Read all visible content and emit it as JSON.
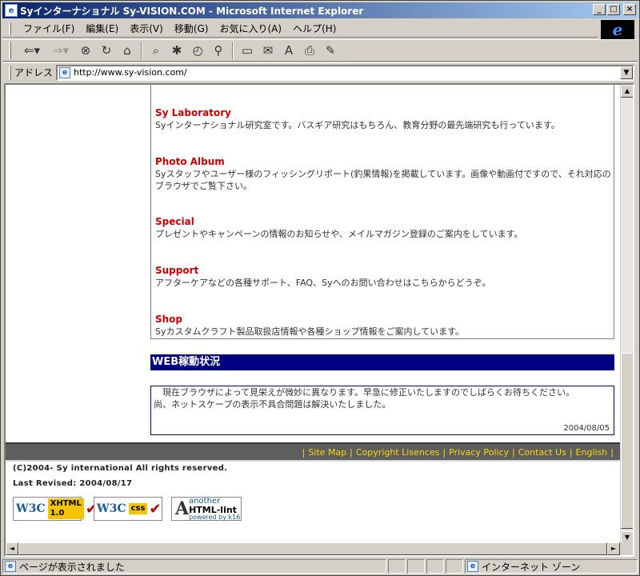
{
  "window": {
    "title": "Syインターナショナル Sy-VISION.COM - Microsoft Internet Explorer"
  },
  "menu": {
    "items": [
      "ファイル(F)",
      "編集(E)",
      "表示(V)",
      "移動(G)",
      "お気に入り(A)",
      "ヘルプ(H)"
    ]
  },
  "toolbar": {
    "buttons": [
      "back-icon",
      "forward-icon",
      "stop-icon",
      "refresh-icon",
      "home-icon",
      "search-icon",
      "favorites-icon",
      "history-icon",
      "channels-icon",
      "fullscreen-icon",
      "mail-icon",
      "font-icon",
      "print-icon",
      "edit-icon"
    ]
  },
  "address": {
    "label": "アドレス",
    "url": "http://www.sy-vision.com/"
  },
  "sections": [
    {
      "title": "Sy Laboratory",
      "desc": "Syインターナショナル研究室です。バスギア研究はもちろん、教育分野の最先端研究も行っています。"
    },
    {
      "title": "Photo Album",
      "desc": "Syスタッフやユーザー様のフィッシングリポート(釣果情報)を掲載しています。画像や動画付ですので、それ対応のブラウザでご覧下さい。"
    },
    {
      "title": "Special",
      "desc": "プレゼントやキャンペーンの情報のお知らせや、メイルマガジン登録のご案内をしています。"
    },
    {
      "title": "Support",
      "desc": "アフターケアなどの各種サポート、FAQ、Syへのお問い合わせはこちらからどうぞ。"
    },
    {
      "title": "Shop",
      "desc": "Syカスタムクラフト製品取扱店情報や各種ショップ情報をご案内しています。"
    }
  ],
  "web_status": {
    "header": "WEB稼動状況",
    "line1": "　現在ブラウザによって見栄えが微妙に異なります。早急に修正いたしますのでしばらくお待ちください。",
    "line2": "尚、ネットスケープの表示不具合問題は解決いたしました。",
    "date": "2004/08/05"
  },
  "footer": {
    "links": [
      "Site Map",
      "Copyright Lisences",
      "Privacy Policy",
      "Contact Us",
      "English"
    ],
    "copyright": "(C)2004- Sy international All rights reserved.",
    "revised": "Last Revised: 2004/08/17"
  },
  "badges": {
    "xhtml": {
      "w3c": "W3C",
      "label": "XHTML 1.0"
    },
    "css": {
      "w3c": "W3C",
      "label": "css"
    },
    "lint": {
      "top": "another",
      "main": "HTML-lint",
      "small": "powered by k16"
    }
  },
  "status": {
    "text": "ページが表示されました",
    "zone": "インターネット ゾーン"
  }
}
